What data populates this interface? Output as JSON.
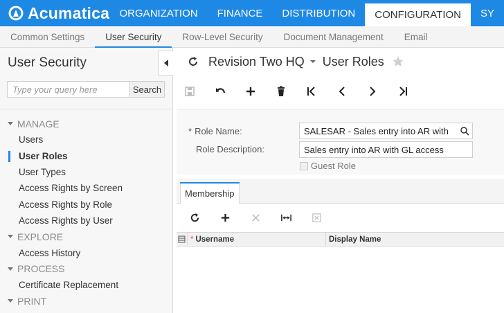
{
  "app": {
    "name": "Acumatica",
    "top_nav": [
      "ORGANIZATION",
      "FINANCE",
      "DISTRIBUTION",
      "CONFIGURATION",
      "SY"
    ],
    "top_nav_active": "CONFIGURATION"
  },
  "sub_tabs": [
    "Common Settings",
    "User Security",
    "Row-Level Security",
    "Document Management",
    "Email"
  ],
  "sub_tab_active": "User Security",
  "sidebar": {
    "title": "User Security",
    "search": {
      "placeholder": "Type your query here",
      "button_label": "Search"
    },
    "sections": [
      {
        "label": "MANAGE",
        "items": [
          "Users",
          "User Roles",
          "User Types",
          "Access Rights by Screen",
          "Access Rights by Role",
          "Access Rights by User"
        ]
      },
      {
        "label": "EXPLORE",
        "items": [
          "Access History"
        ]
      },
      {
        "label": "PROCESS",
        "items": [
          "Certificate Replacement"
        ]
      },
      {
        "label": "PRINT",
        "items": []
      }
    ],
    "active_item": "User Roles"
  },
  "header": {
    "company": "Revision Two HQ",
    "screen_title": "User Roles"
  },
  "toolbar": {
    "icons": [
      "save-icon",
      "undo-icon",
      "add-icon",
      "delete-icon",
      "first-record-icon",
      "previous-record-icon",
      "next-record-icon",
      "last-record-icon"
    ]
  },
  "form": {
    "role_name_label": "Role Name:",
    "role_name_value": "SALESAR - Sales entry into AR with",
    "role_description_label": "Role Description:",
    "role_description_value": "Sales entry into AR with GL access",
    "guest_role_label": "Guest Role",
    "guest_role_checked": false,
    "required_marker": "*"
  },
  "tabs": {
    "membership": "Membership"
  },
  "grid": {
    "toolbar_icons": [
      "refresh-icon",
      "add-row-icon",
      "delete-row-icon",
      "fit-columns-icon",
      "export-excel-icon"
    ],
    "columns": [
      {
        "label": "Username",
        "required": true
      },
      {
        "label": "Display Name",
        "required": false
      }
    ],
    "rows": []
  },
  "colors": {
    "accent": "#1e88e5",
    "topbar": "#1e88e5"
  }
}
